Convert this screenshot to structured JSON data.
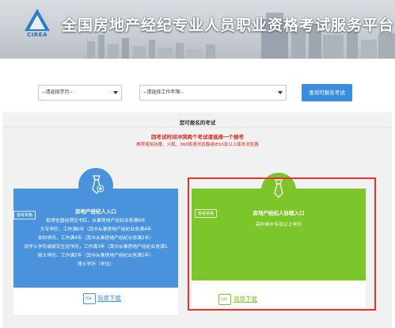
{
  "header": {
    "logo_text": "CIREA",
    "title": "全国房地产经纪专业人员职业资格考试服务平台"
  },
  "filters": {
    "education_select": "--请选择学历--",
    "work_years_select": "--请选择工作年限--",
    "query_button": "查询可报名考试"
  },
  "panel": {
    "title": "您可报名的考试",
    "notice": "因考试时间冲突两个考试请选择一个报考",
    "browser_tip": "推荐使用谷歌、火狐、360极速浏览器或IE10及以上版本浏览器"
  },
  "cards": [
    {
      "tag": "报考资格",
      "heading": "房地产经纪人入口",
      "requirements": [
        "取得全国经理证书后，从事房地产经纪业务满6年",
        "大专学历，工作满6年（其中从事房地产经纪业务满4年",
        "本科学历，工作满4年（其中从事房地产经纪业务满2年）",
        "双学士学历或研究生班学历，工作满3年（其中从事房地产经纪业务满1",
        "硕士学历，工作满2年（其中从事房地产经纪业务满1年）",
        "博士学历（学位）"
      ],
      "download": "简章下载",
      "icon_label": "简章",
      "color": "#4a93dc",
      "icon": "tie-icon"
    },
    {
      "tag": "报考资格",
      "heading": "房地产经纪人协理入口",
      "requirements": [
        "高中或中专及以上学历"
      ],
      "download": "简章下载",
      "icon_label": "简章",
      "color": "#7cc52a",
      "icon": "tie-icon"
    }
  ],
  "colors": {
    "highlight_box": "#e8322a",
    "notice_red": "#d9261c",
    "query_button": "#3b8de0"
  }
}
